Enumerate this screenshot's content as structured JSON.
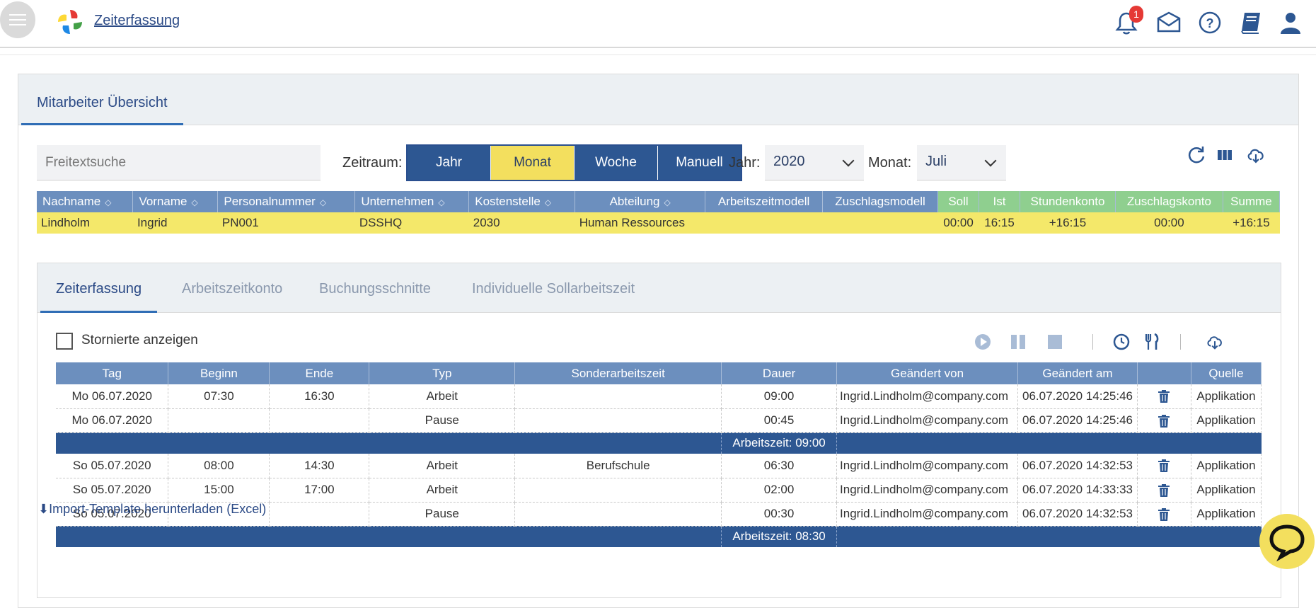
{
  "header": {
    "title": "Zeiterfassung",
    "notification_count": "1",
    "icons": [
      "menu-icon",
      "app-logo",
      "bell-icon",
      "inbox-icon",
      "help-icon",
      "book-icon",
      "user-icon"
    ]
  },
  "panel": {
    "tab": "Mitarbeiter Übersicht"
  },
  "filters": {
    "search_placeholder": "Freitextsuche",
    "zeitraum_label": "Zeitraum:",
    "periods": [
      "Jahr",
      "Monat",
      "Woche",
      "Manuell"
    ],
    "active_period": "Monat",
    "jahr_label": "Jahr:",
    "jahr_value": "2020",
    "monat_label": "Monat:",
    "monat_value": "Juli"
  },
  "employee_table": {
    "columns": [
      "Nachname",
      "Vorname",
      "Personalnummer",
      "Unternehmen",
      "Kostenstelle",
      "Abteilung",
      "Arbeitszeitmodell",
      "Zuschlagsmodell",
      "Soll",
      "Ist",
      "Stundenkonto",
      "Zuschlagskonto",
      "Summe"
    ],
    "row": [
      "Lindholm",
      "Ingrid",
      "PN001",
      "DSSHQ",
      "2030",
      "Human Ressources",
      "",
      "",
      "00:00",
      "16:15",
      "+16:15",
      "00:00",
      "+16:15"
    ]
  },
  "subtabs": [
    "Zeiterfassung",
    "Arbeitszeitkonto",
    "Buchungsschnitte",
    "Individuelle Sollarbeitszeit"
  ],
  "options": {
    "show_cancelled_label": "Stornierte anzeigen"
  },
  "time_table": {
    "columns": [
      "Tag",
      "Beginn",
      "Ende",
      "Typ",
      "Sonderarbeitszeit",
      "Dauer",
      "Geändert von",
      "Geändert am",
      "",
      "Quelle"
    ],
    "rows": [
      [
        "Mo 06.07.2020",
        "07:30",
        "16:30",
        "Arbeit",
        "",
        "09:00",
        "Ingrid.Lindholm@company.com",
        "06.07.2020 14:25:46",
        "Applikation"
      ],
      [
        "Mo 06.07.2020",
        "",
        "",
        "Pause",
        "",
        "00:45",
        "Ingrid.Lindholm@company.com",
        "06.07.2020 14:25:46",
        "Applikation"
      ],
      [
        "So 05.07.2020",
        "08:00",
        "14:30",
        "Arbeit",
        "Berufschule",
        "06:30",
        "Ingrid.Lindholm@company.com",
        "06.07.2020 14:32:53",
        "Applikation"
      ],
      [
        "So 05.07.2020",
        "15:00",
        "17:00",
        "Arbeit",
        "",
        "02:00",
        "Ingrid.Lindholm@company.com",
        "06.07.2020 14:33:33",
        "Applikation"
      ],
      [
        "So 05.07.2020",
        "",
        "",
        "Pause",
        "",
        "00:30",
        "Ingrid.Lindholm@company.com",
        "06.07.2020 14:32:53",
        "Applikation"
      ]
    ],
    "summaries": [
      "Arbeitszeit: 09:00",
      "Arbeitszeit: 08:30"
    ]
  },
  "footer": {
    "download_link": "Import-Template herunterladen (Excel)"
  },
  "colors": {
    "primary": "#2d5792",
    "header_blue": "#6c8fbe",
    "highlight_yellow": "#f3df5e",
    "green_header": "#8fcf8f"
  }
}
